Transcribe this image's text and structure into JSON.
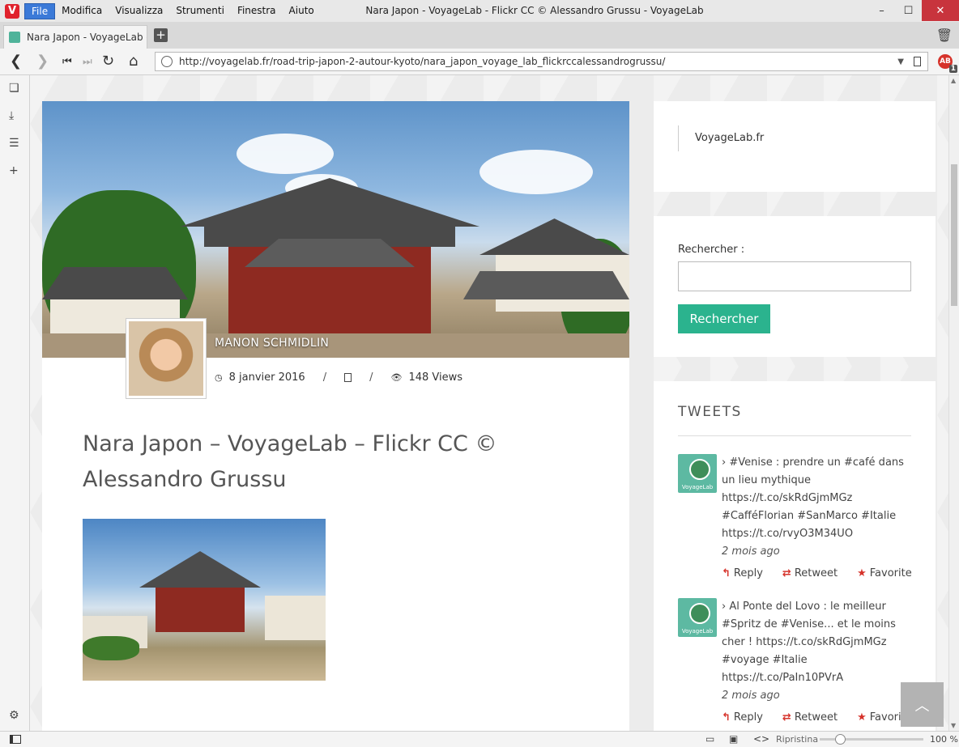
{
  "titlebar": {
    "logo": "V",
    "menu": [
      "File",
      "Modifica",
      "Visualizza",
      "Strumenti",
      "Finestra",
      "Aiuto"
    ],
    "window_title": "Nara Japon - VoyageLab - Flickr CC © Alessandro Grussu - VoyageLab",
    "controls": [
      "–",
      "☐",
      "✕"
    ]
  },
  "tabs": [
    {
      "label": "Nara Japon - VoyageLab - F"
    }
  ],
  "newtab_label": "+",
  "addressbar": {
    "url": "http://voyagelab.fr/road-trip-japon-2-autour-kyoto/nara_japon_voyage_lab_flickrccalessandrogrussu/",
    "adblock_label": "AB",
    "adblock_count": "1"
  },
  "article": {
    "author": "MANON SCHMIDLIN",
    "date": "8 janvier 2016",
    "views": "148 Views",
    "title": "Nara Japon – VoyageLab – Flickr CC © Alessandro Grussu"
  },
  "sidebar": {
    "site_link": "VoyageLab.fr",
    "search_label": "Rechercher :",
    "search_value": "",
    "search_button": "Rechercher",
    "tweets_title": "TWEETS",
    "tweets": [
      {
        "avatar_label": "VoyageLab",
        "text": "›   #Venise : prendre un #café dans un lieu mythique https://t.co/skRdGjmMGz #CafféFlorian #SanMarco #Italie https://t.co/rvyO3M34UO",
        "ago": "2 mois ago",
        "reply": "Reply",
        "retweet": "Retweet",
        "favorite": "Favorite"
      },
      {
        "avatar_label": "VoyageLab",
        "text": "›   Al Ponte del Lovo : le meilleur #Spritz de #Venise... et le moins cher ! https://t.co/skRdGjmMGz #voyage #Italie https://t.co/PaIn10PVrA",
        "ago": "2 mois ago",
        "reply": "Reply",
        "retweet": "Retweet",
        "favorite": "Favorite"
      }
    ]
  },
  "statusbar": {
    "reset_label": "Ripristina",
    "zoom": "100 %"
  },
  "colors": {
    "accent_green": "#2bb38e",
    "vivaldi_red": "#e0222c",
    "menu_active": "#3b7ad8"
  }
}
